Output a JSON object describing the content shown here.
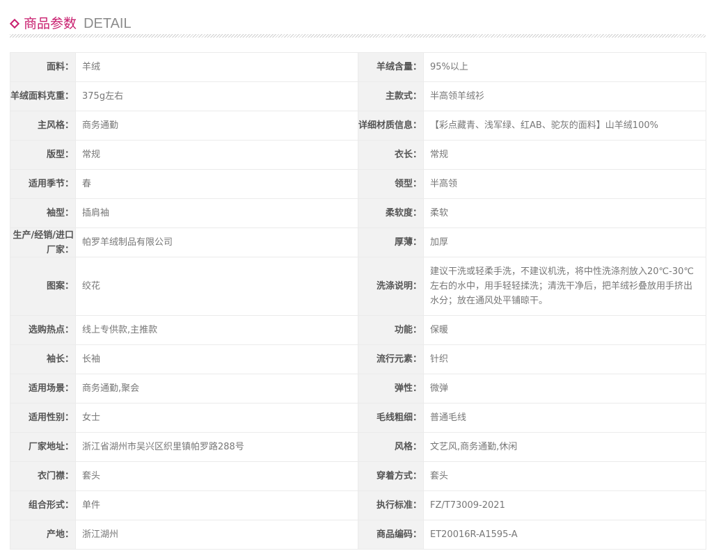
{
  "header": {
    "title_cn": "商品参数",
    "title_en": "DETAIL"
  },
  "colors": {
    "accent": "#c81e6e",
    "label_bg": "#f2f2f2",
    "border": "#ebebeb",
    "value_text": "#777777",
    "label_text": "#555555"
  },
  "params": [
    {
      "label_left": "面料：",
      "value_left": "羊绒",
      "label_right": "羊绒含量：",
      "value_right": "95%以上"
    },
    {
      "label_left": "羊绒面料克重：",
      "value_left": "375g左右",
      "label_right": "主款式：",
      "value_right": "半高领羊绒衫"
    },
    {
      "label_left": "主风格：",
      "value_left": "商务通勤",
      "label_right": "详细材质信息：",
      "value_right": "【彩点藏青、浅军绿、红AB、驼灰的面料】山羊绒100%"
    },
    {
      "label_left": "版型：",
      "value_left": "常规",
      "label_right": "衣长：",
      "value_right": "常规"
    },
    {
      "label_left": "适用季节：",
      "value_left": "春",
      "label_right": "领型：",
      "value_right": "半高领"
    },
    {
      "label_left": "袖型：",
      "value_left": "插肩袖",
      "label_right": "柔软度：",
      "value_right": "柔软"
    },
    {
      "label_left": "生产/经销/进口厂家：",
      "value_left": "帕罗羊绒制品有限公司",
      "label_right": "厚薄：",
      "value_right": "加厚"
    },
    {
      "label_left": "图案：",
      "value_left": "绞花",
      "label_right": "洗涤说明：",
      "value_right": "建议干洗或轻柔手洗，不建议机洗，将中性洗涤剂放入20℃-30℃左右的水中，用手轻轻揉洗；清洗干净后，把羊绒衫叠放用手挤出水分；放在通风处平铺晾干。"
    },
    {
      "label_left": "选购热点：",
      "value_left": "线上专供款,主推款",
      "label_right": "功能：",
      "value_right": "保暖"
    },
    {
      "label_left": "袖长：",
      "value_left": "长袖",
      "label_right": "流行元素：",
      "value_right": "针织"
    },
    {
      "label_left": "适用场景：",
      "value_left": "商务通勤,聚会",
      "label_right": "弹性：",
      "value_right": "微弹"
    },
    {
      "label_left": "适用性别：",
      "value_left": "女士",
      "label_right": "毛线粗细：",
      "value_right": "普通毛线"
    },
    {
      "label_left": "厂家地址：",
      "value_left": "浙江省湖州市吴兴区织里镇帕罗路288号",
      "label_right": "风格：",
      "value_right": "文艺风,商务通勤,休闲"
    },
    {
      "label_left": "衣门襟：",
      "value_left": "套头",
      "label_right": "穿着方式：",
      "value_right": "套头"
    },
    {
      "label_left": "组合形式：",
      "value_left": "单件",
      "label_right": "执行标准：",
      "value_right": "FZ/T73009-2021"
    },
    {
      "label_left": "产地：",
      "value_left": "浙江湖州",
      "label_right": "商品编码：",
      "value_right": "ET20016R-A1595-A"
    }
  ]
}
